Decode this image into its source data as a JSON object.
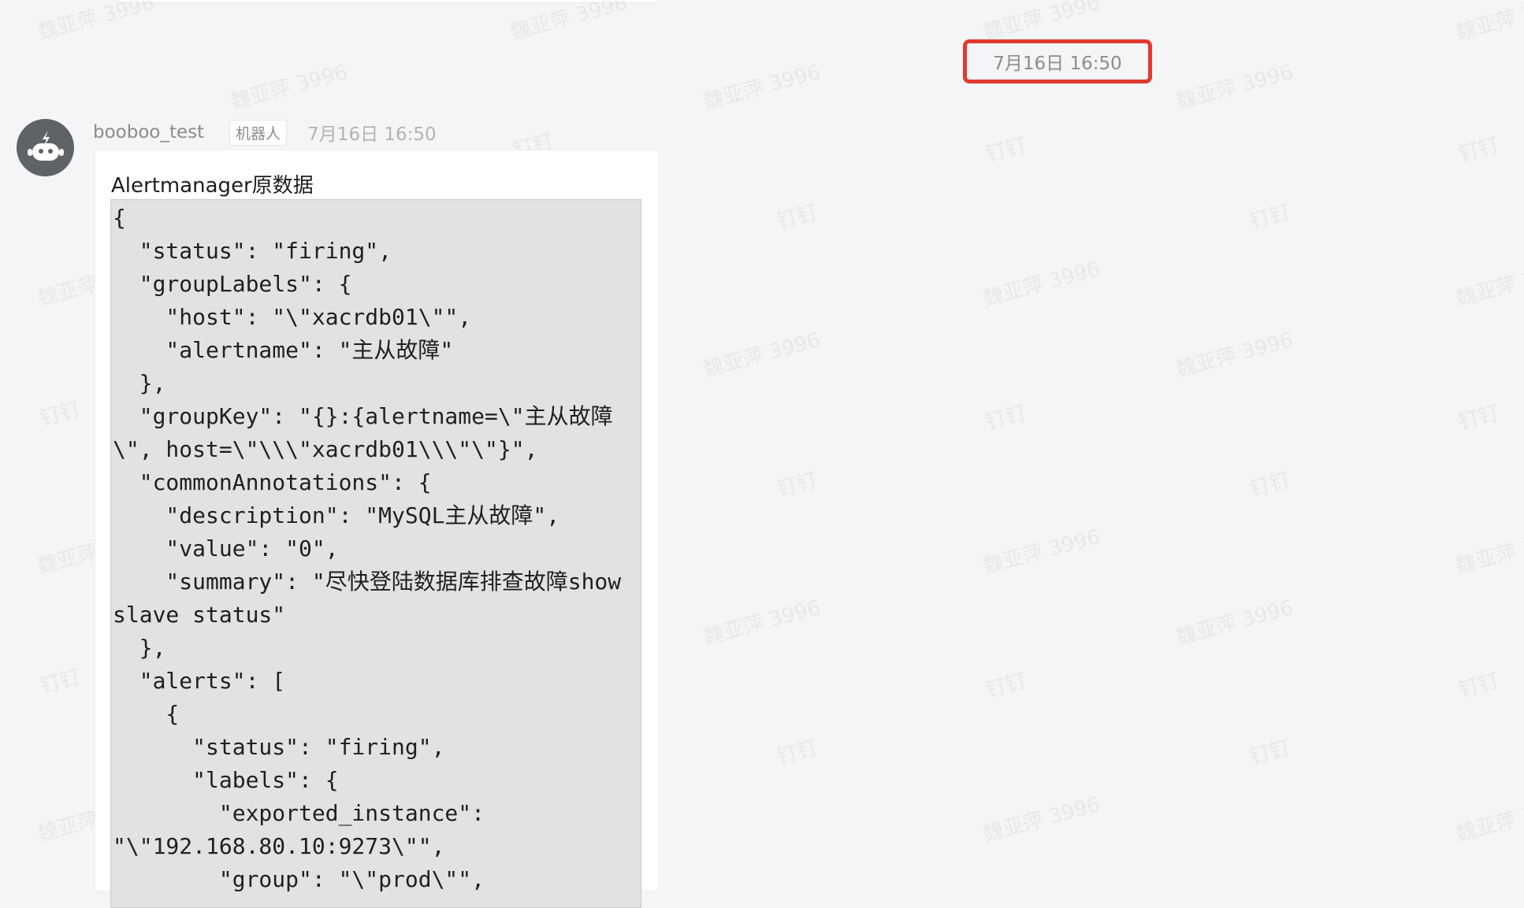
{
  "chat": {
    "divider_time": "7月16日 16:50",
    "message": {
      "sender": "booboo_test",
      "badge": "机器人",
      "time": "7月16日 16:50",
      "title": "Alertmanager原数据",
      "code": "{\n  \"status\": \"firing\",\n  \"groupLabels\": {\n    \"host\": \"\\\"xacrdb01\\\"\",\n    \"alertname\": \"主从故障\"\n  },\n  \"groupKey\": \"{}:{alertname=\\\"主从故障\n\\\", host=\\\"\\\\\\\"xacrdb01\\\\\\\"\\\"}\",\n  \"commonAnnotations\": {\n    \"description\": \"MySQL主从故障\",\n    \"value\": \"0\",\n    \"summary\": \"尽快登陆数据库排查故障show\nslave status\"\n  },\n  \"alerts\": [\n    {\n      \"status\": \"firing\",\n      \"labels\": {\n        \"exported_instance\":\n\"\\\"192.168.80.10:9273\\\"\",\n        \"group\": \"\\\"prod\\\"\","
    }
  },
  "watermark": {
    "name": "魏亚萍 3996",
    "app": "钉钉"
  },
  "icons": {
    "avatar": "robot-icon"
  },
  "colors": {
    "background": "#f4f5f7",
    "highlight_border": "#e23a2f",
    "avatar": "#5f6368",
    "code_background": "#e2e2e2"
  }
}
